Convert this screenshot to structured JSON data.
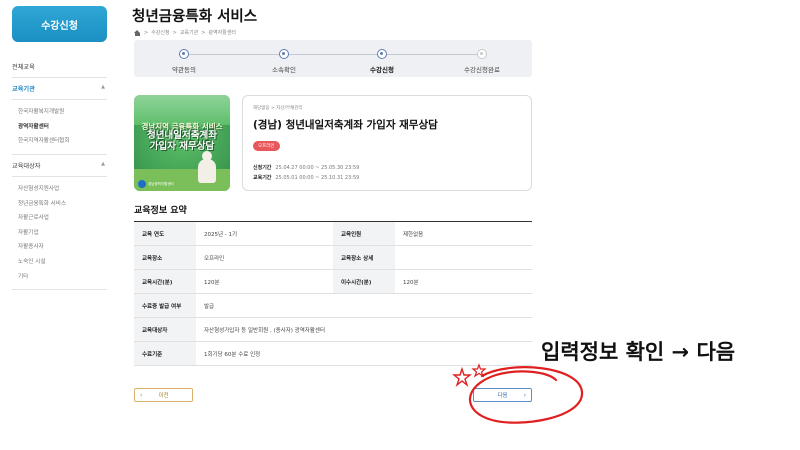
{
  "sidebar": {
    "apply_button": "수강신청",
    "sections": [
      {
        "label": "전체교육",
        "items": []
      },
      {
        "label": "교육기관",
        "items": [
          "한국자활복지개발원",
          "광역자활센터",
          "한국지역자활센터협회"
        ],
        "selected": "광역자활센터"
      },
      {
        "label": "교육대상자",
        "items": [
          "자산형성지원사업",
          "청년금융특화 서비스",
          "자활근로사업",
          "자활기업",
          "자활종사자",
          "노숙인 시설",
          "기타"
        ]
      }
    ]
  },
  "header": {
    "title": "청년금융특화 서비스",
    "breadcrumb": [
      "수강신청",
      "교육기관",
      "광역자활센터"
    ]
  },
  "steps": {
    "items": [
      "약관동의",
      "소속확인",
      "수강신청",
      "수강신청완료"
    ],
    "current": "수강신청"
  },
  "course": {
    "thumb": {
      "line1": "경남지역 금융특화 서비스",
      "line2": "청년내일저축계좌",
      "line3": "가입자 재무상담",
      "org": "경남광역자활센터"
    },
    "category": "해당없음 > 자산/부채관리",
    "name": "(경남) 청년내일저축계좌 가입자 재무상담",
    "tag": "오프라인",
    "apply_label": "신청기간",
    "apply_period": "25.04.27 00:00 ~ 25.05.30 23:59",
    "edu_label": "교육기간",
    "edu_period": "25.05.01 00:00 ~ 25.10.31 23:59"
  },
  "summary": {
    "title": "교육정보 요약",
    "rows": [
      {
        "k1": "교육 연도",
        "v1": "2025년 - 1기",
        "k2": "교육인원",
        "v2": "제한없음"
      },
      {
        "k1": "교육장소",
        "v1": "오프라인",
        "k2": "교육장소 상세",
        "v2": ""
      },
      {
        "k1": "교육시간(분)",
        "v1": "120분",
        "k2": "이수시간(분)",
        "v2": "120분"
      },
      {
        "k1": "수료증 발급 여부",
        "v1": "발급"
      },
      {
        "k1": "교육대상자",
        "v1": "자산형성가입자 등 일반회원 , (종사자) 광역자활센터"
      },
      {
        "k1": "수료기준",
        "v1": "1회기당 60분 수료 인정"
      }
    ]
  },
  "buttons": {
    "prev": "이전",
    "next": "다음"
  },
  "annotation": {
    "text": "입력정보 확인 → 다음",
    "color": "#e02020"
  }
}
